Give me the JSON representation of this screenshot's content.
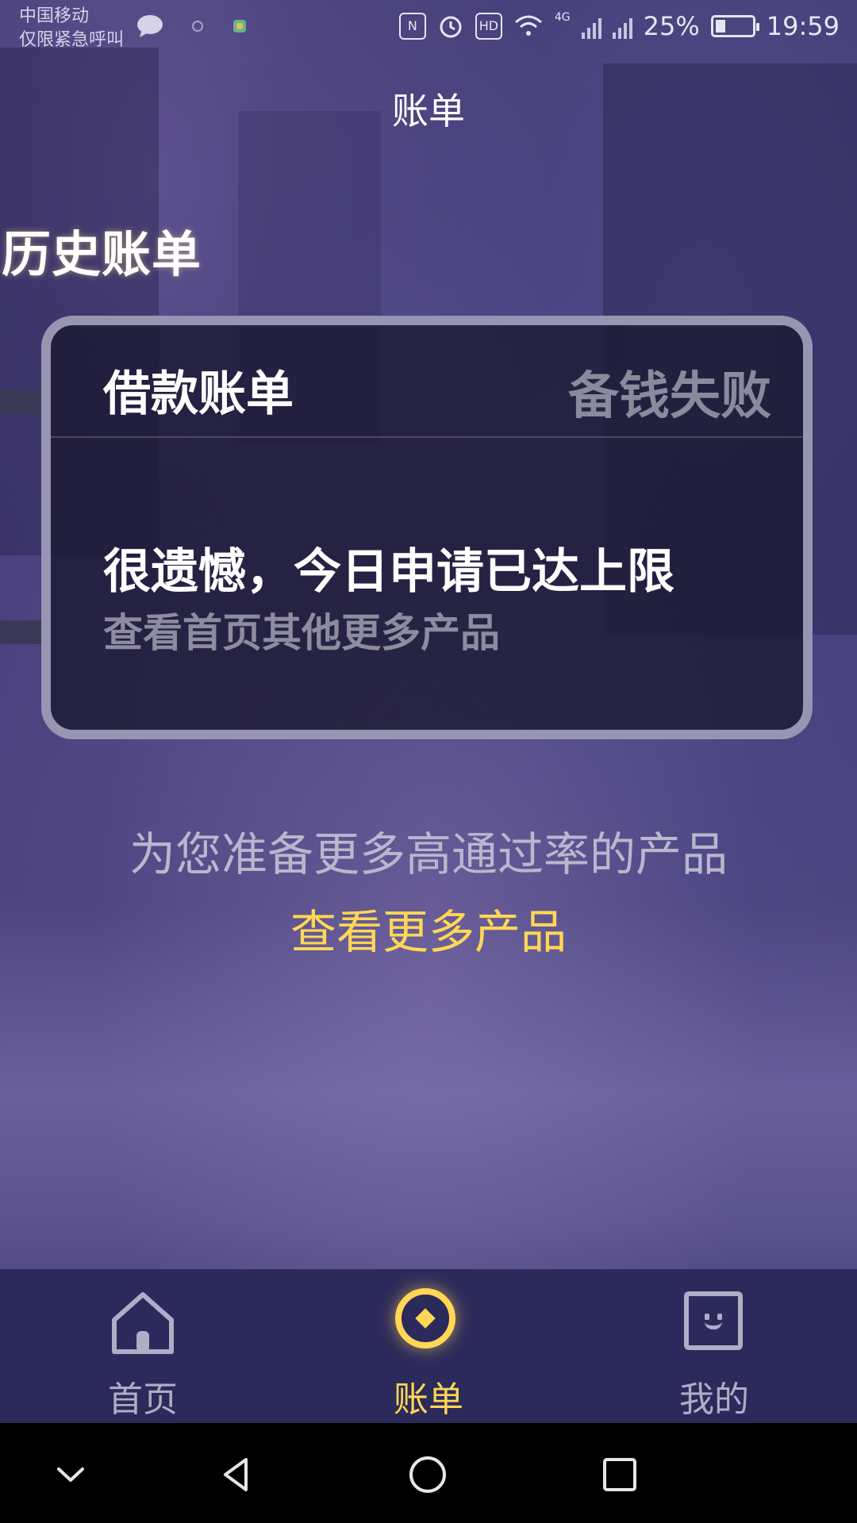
{
  "status_bar": {
    "carrier_line1": "中国移动",
    "carrier_line2": "仅限紧急呼叫",
    "network_label": "4G",
    "hd_label": "HD",
    "battery_percent": "25%",
    "time": "19:59"
  },
  "header": {
    "title": "账单"
  },
  "section": {
    "title": "历史账单"
  },
  "card": {
    "title": "借款账单",
    "status": "备钱失败",
    "message": "很遗憾，今日申请已达上限",
    "sub_message": "查看首页其他更多产品"
  },
  "recommend": {
    "text": "为您准备更多高通过率的产品",
    "link_label": "查看更多产品",
    "link_color": "#ffd755"
  },
  "tab_bar": {
    "items": [
      {
        "label": "首页",
        "icon": "home-icon",
        "active": false
      },
      {
        "label": "账单",
        "icon": "bill-icon",
        "active": true
      },
      {
        "label": "我的",
        "icon": "profile-icon",
        "active": false
      }
    ],
    "active_color": "#ffd755",
    "inactive_color": "#b0adc6"
  },
  "system_nav": {
    "buttons": [
      "chevron-down-icon",
      "back-icon",
      "home-circle-icon",
      "recents-icon"
    ]
  }
}
